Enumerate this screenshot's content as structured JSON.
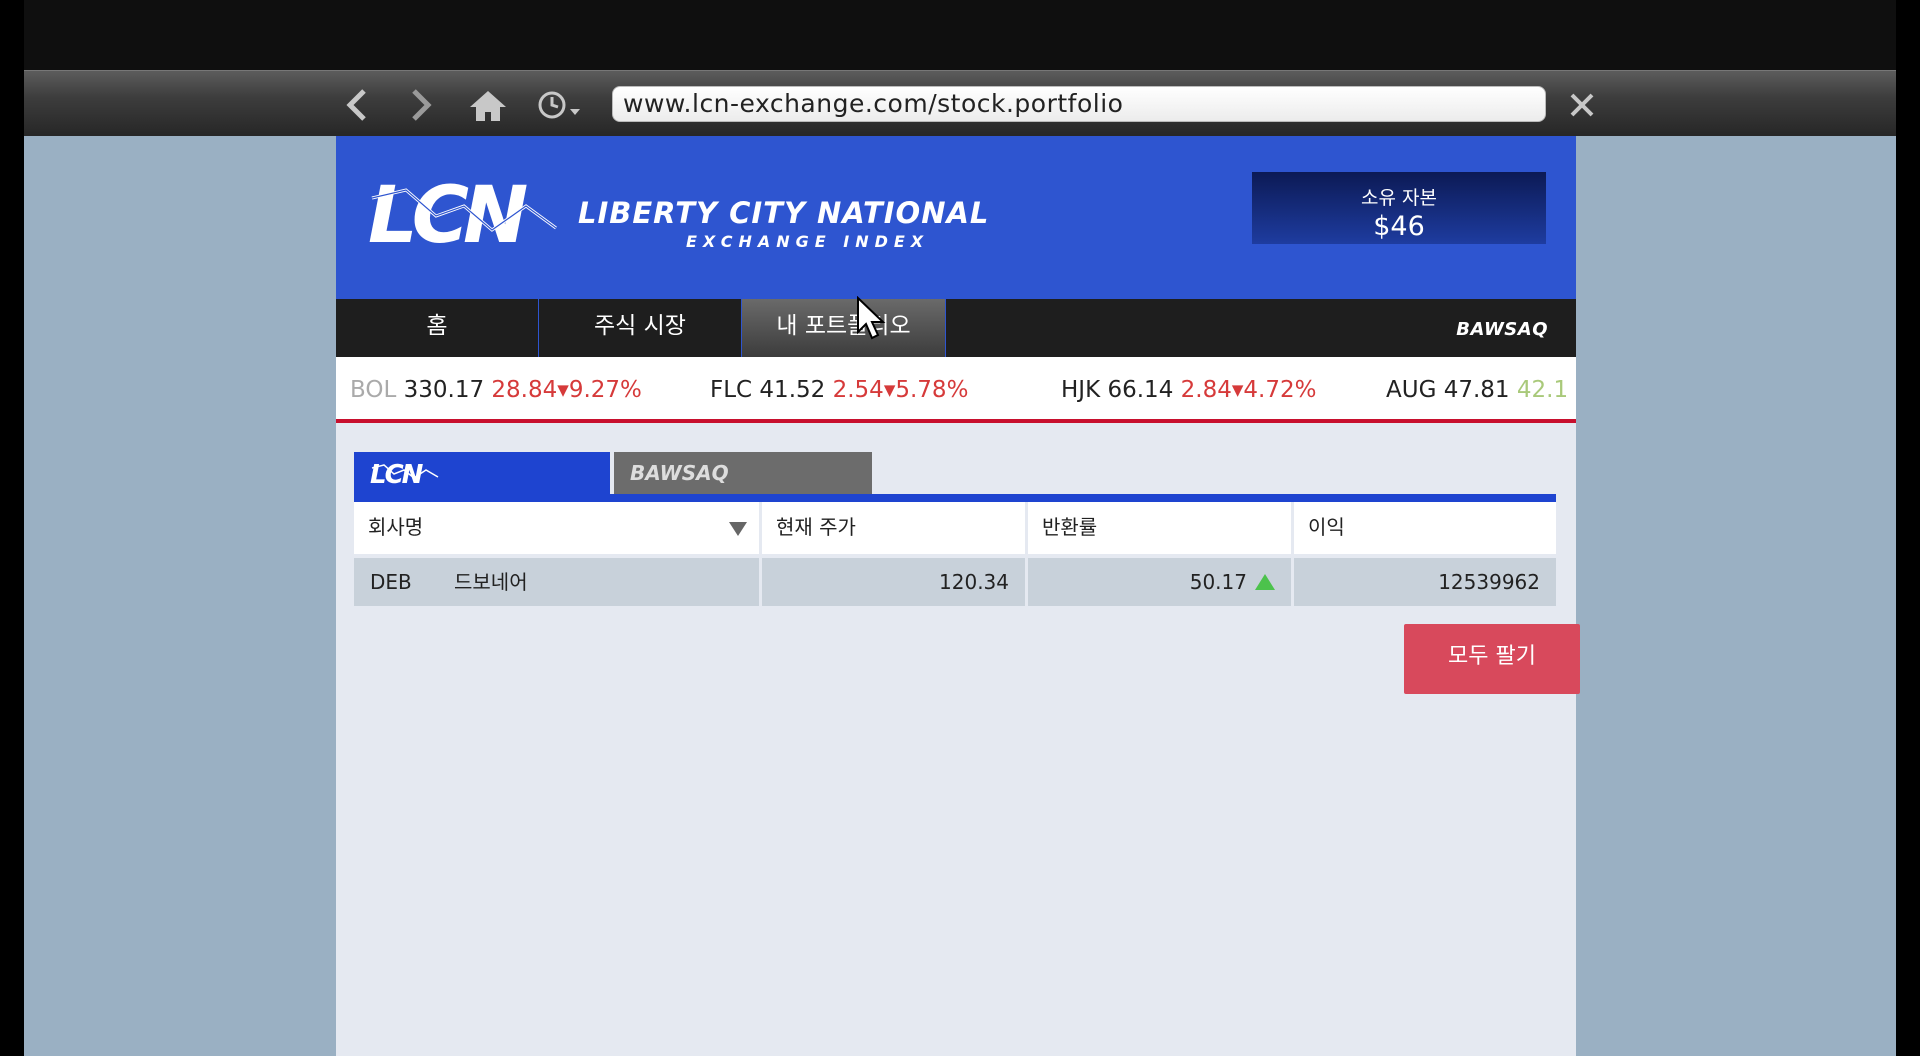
{
  "browser": {
    "url": "www.lcn-exchange.com/stock.portfolio"
  },
  "header": {
    "logo_text": "LCN",
    "brand_name": "LIBERTY CITY NATIONAL",
    "brand_sub": "EXCHANGE INDEX",
    "capital_label": "소유 자본",
    "capital_value": "$46"
  },
  "nav": {
    "tabs": [
      {
        "label": "홈"
      },
      {
        "label": "주식 시장"
      },
      {
        "label": "내 포트폴리오",
        "active": true
      }
    ],
    "bawsaq": "BAWSAQ"
  },
  "ticker": [
    {
      "symbol": "BOL",
      "price": "330.17",
      "change": "28.84",
      "percent": "9.27%",
      "direction": "down"
    },
    {
      "symbol": "FLC",
      "price": "41.52",
      "change": "2.54",
      "percent": "5.78%",
      "direction": "down"
    },
    {
      "symbol": "HJK",
      "price": "66.14",
      "change": "2.84",
      "percent": "4.72%",
      "direction": "down"
    },
    {
      "symbol": "AUG",
      "price": "47.81",
      "change": "42.1",
      "percent": "",
      "direction": "up"
    }
  ],
  "exchange_tabs": {
    "lcn": "LCN",
    "bawsaq": "BAWSAQ"
  },
  "table": {
    "headers": [
      "회사명",
      "현재 주가",
      "반환률",
      "이익"
    ],
    "rows": [
      {
        "ticker": "DEB",
        "name": "드보네어",
        "price": "120.34",
        "return": "50.17",
        "return_direction": "up",
        "profit": "12539962"
      }
    ]
  },
  "actions": {
    "sell_all": "모두 팔기"
  },
  "colors": {
    "header_blue": "#2e55d0",
    "ticker_down": "#d63a3a",
    "ticker_up": "#a9c97a",
    "sell_button": "#d8495c",
    "up_arrow": "#4cc24c"
  }
}
